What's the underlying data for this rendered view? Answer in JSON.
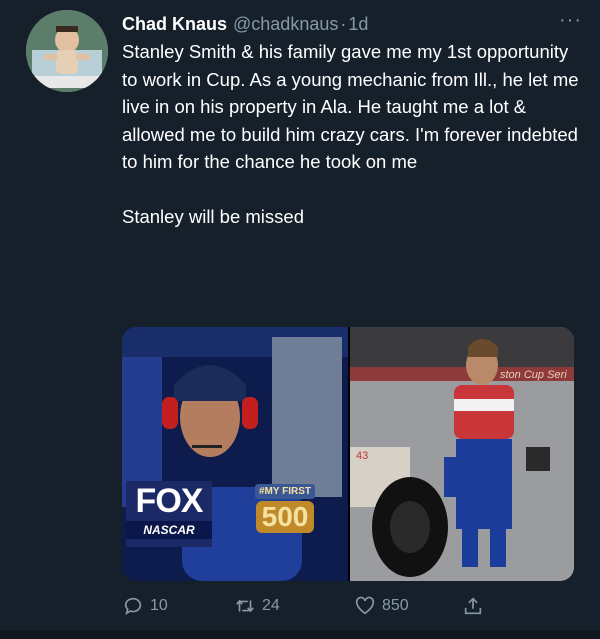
{
  "tweet": {
    "author_name": "Chad Knaus",
    "author_handle": "@chadknaus",
    "separator": "·",
    "time": "1d",
    "more_label": "···",
    "text": "Stanley Smith & his family gave me my 1st opportunity to work in Cup. As a young mechanic from Ill., he let me live in on his property in Ala. He taught me a lot & allowed me to build him crazy cars. I'm forever indebted to him for the chance he took on me\n\nStanley will be missed",
    "media": {
      "left": {
        "logo_text": "FOX",
        "logo_sub": "NASCAR",
        "badge_tag": "#MY FIRST",
        "badge_num": "500"
      },
      "right": {
        "banner_text": "ston Cup Seri",
        "car_number": "43"
      }
    },
    "actions": {
      "reply_count": "10",
      "retweet_count": "24",
      "like_count": "850"
    }
  },
  "colors": {
    "background": "#15202b",
    "text": "#ffffff",
    "secondary": "#8899a6"
  }
}
